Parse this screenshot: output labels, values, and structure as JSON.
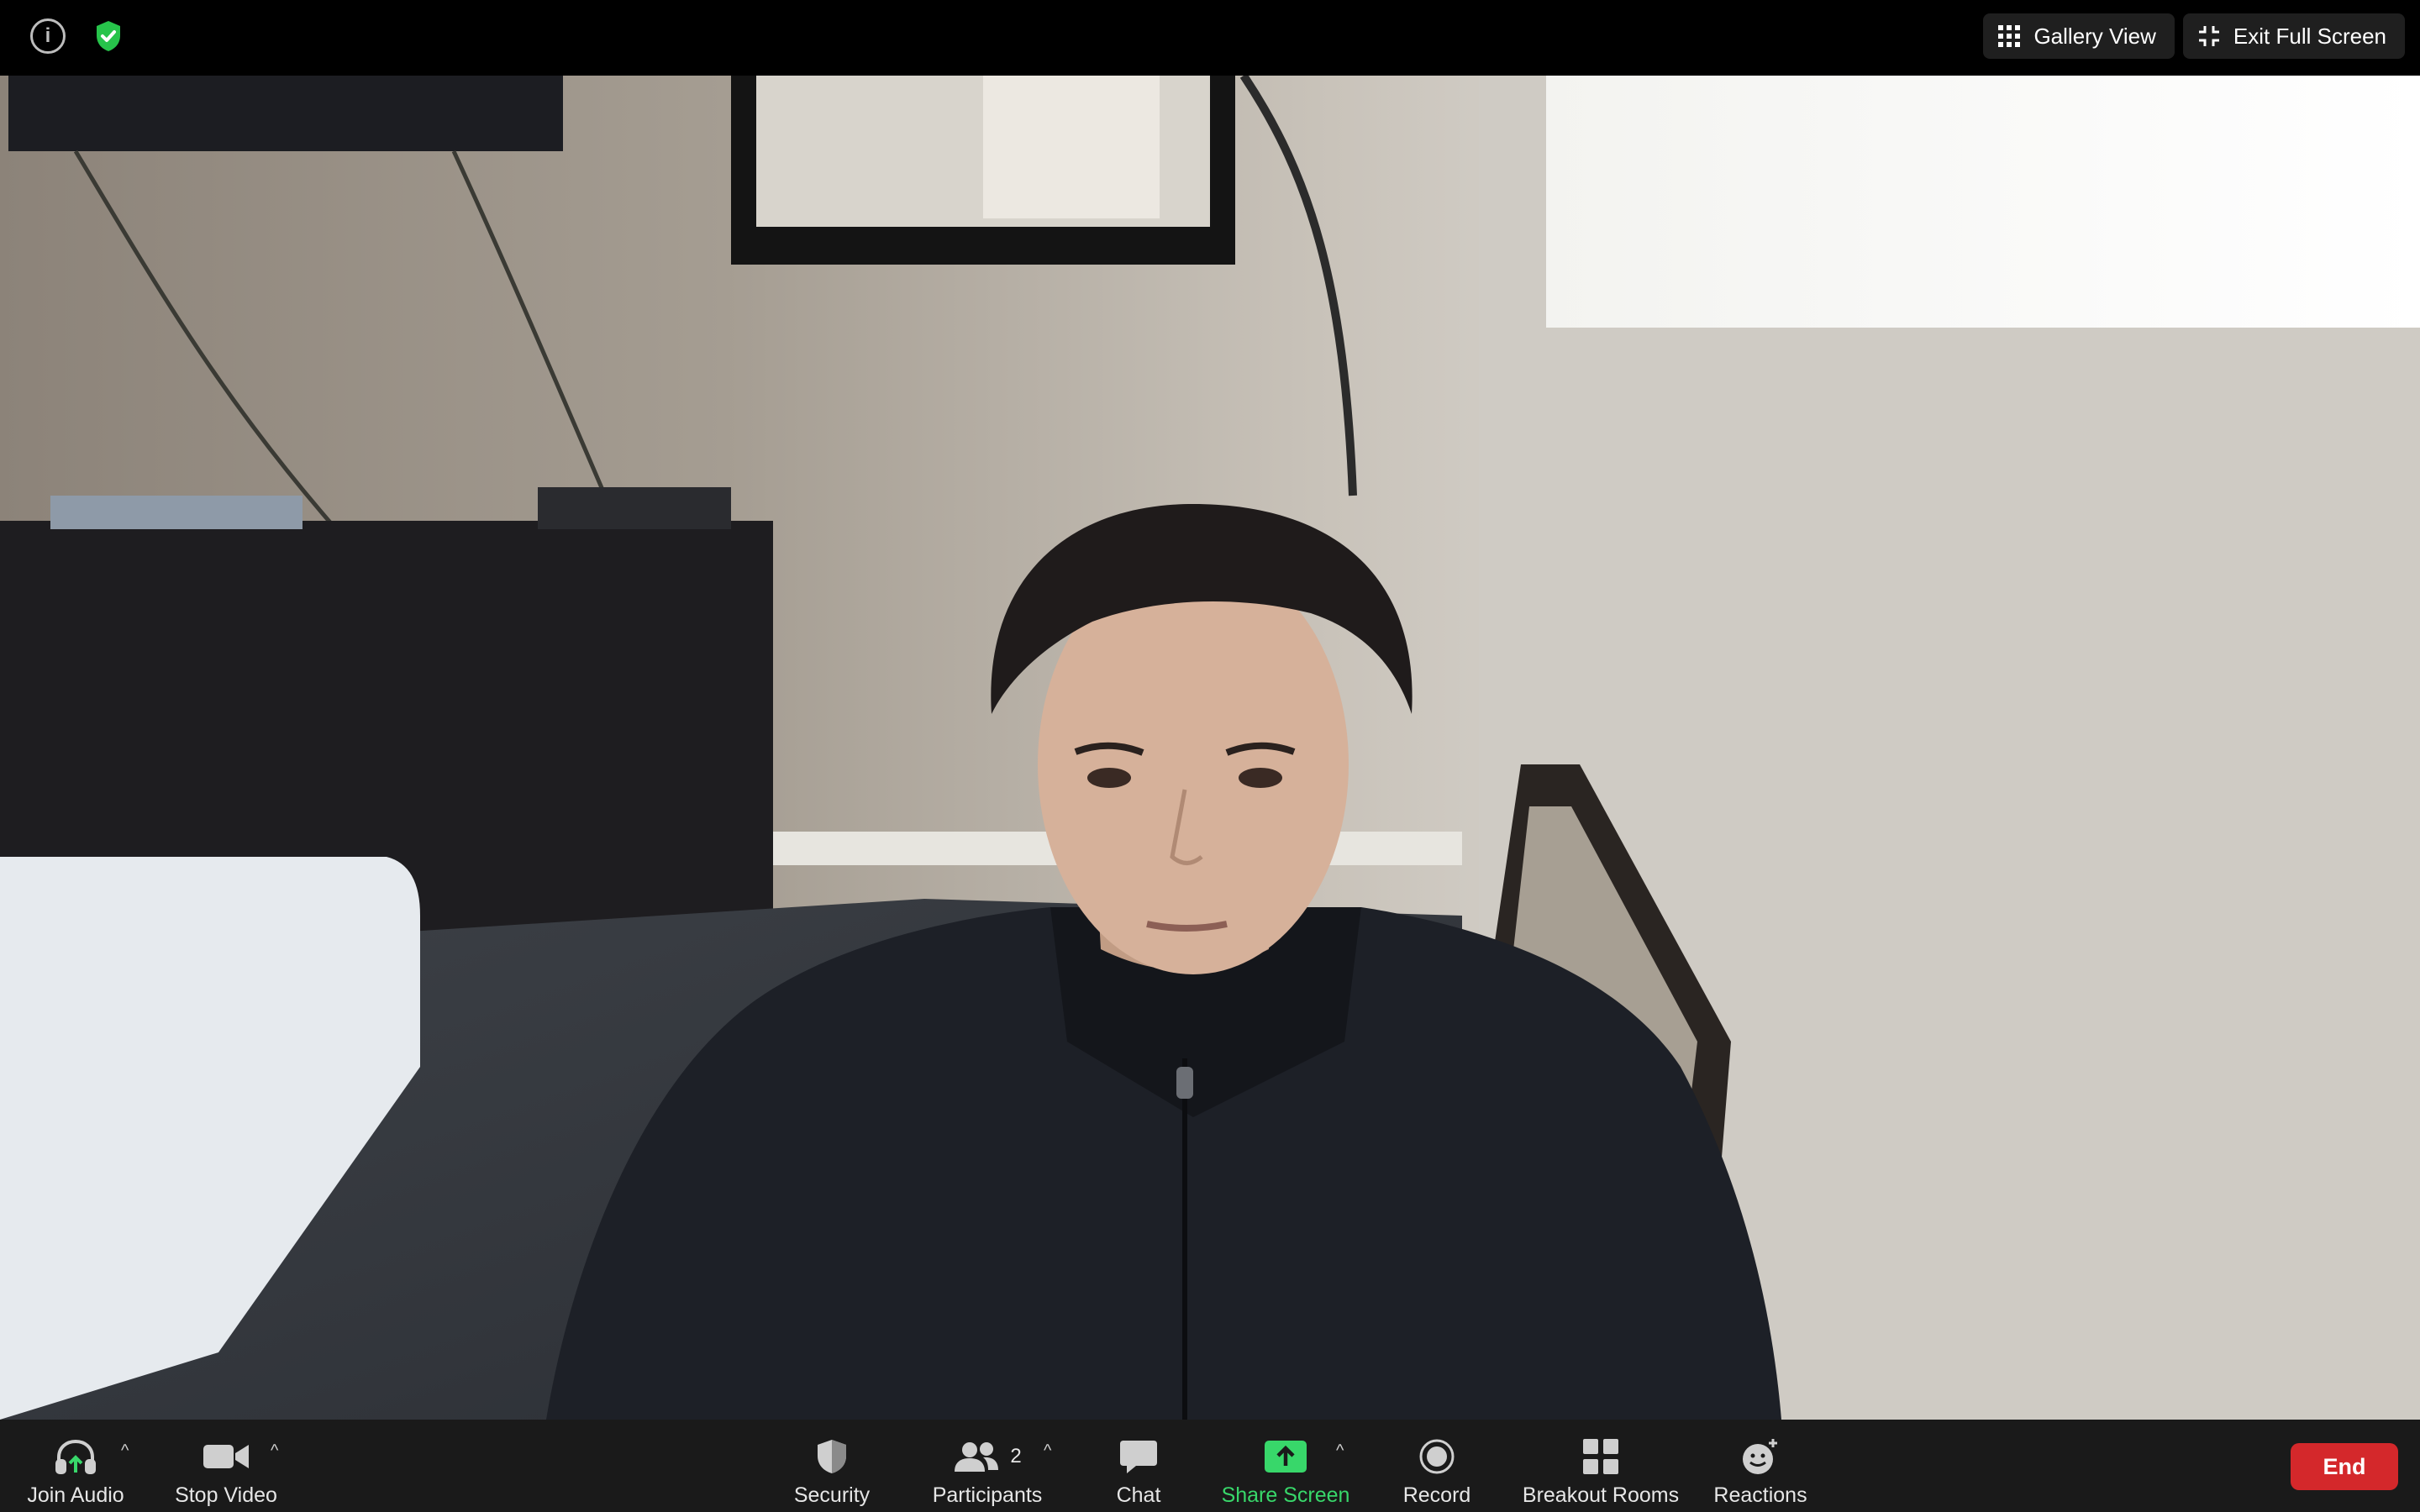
{
  "top_bar": {
    "gallery_view_label": "Gallery View",
    "exit_full_screen_label": "Exit Full Screen",
    "icons": [
      "info-icon",
      "shield-check-icon",
      "grid-icon",
      "exit-fullscreen-icon"
    ],
    "shield_color": "#27c44b"
  },
  "toolbar": {
    "join_audio": "Join Audio",
    "stop_video": "Stop Video",
    "security": "Security",
    "participants": "Participants",
    "participant_count": "2",
    "chat": "Chat",
    "share_screen": "Share Screen",
    "record": "Record",
    "breakout_rooms": "Breakout Rooms",
    "reactions": "Reactions",
    "end": "End",
    "share_color": "#38d76a",
    "end_color": "#d4282b"
  }
}
